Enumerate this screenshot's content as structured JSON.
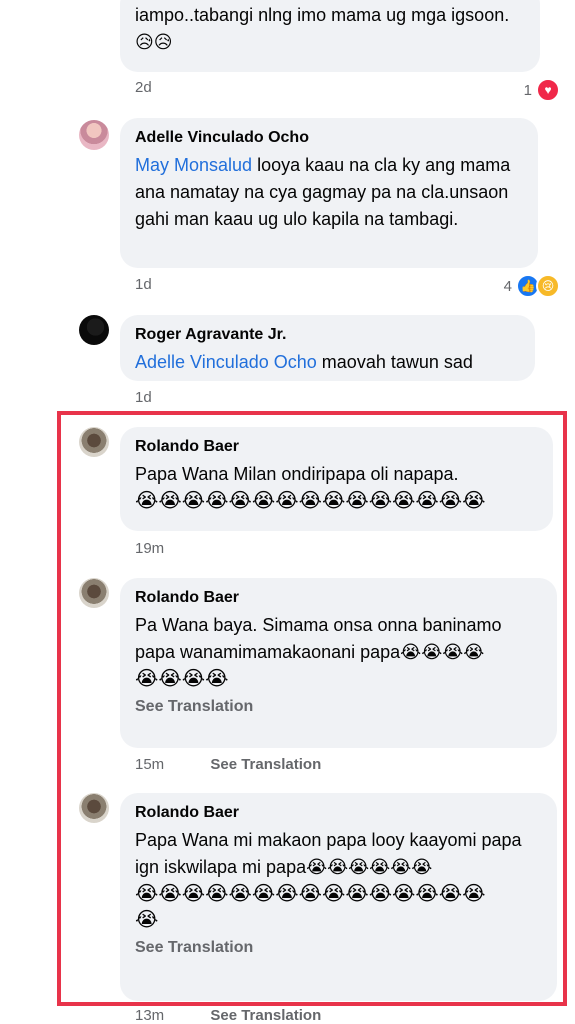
{
  "comments": [
    {
      "text": "iampo..tabangi nlng imo mama ug mga igsoon.😥😥",
      "time": "2d",
      "reaction_count": "1",
      "reaction_icons": [
        "heart-icon"
      ]
    },
    {
      "name": "Adelle Vinculado Ocho",
      "mention": "May Monsalud",
      "text": " looya kaau na cla ky ang mama ana namatay na cya gagmay pa na cla.unsaon gahi man kaau ug ulo kapila na tambagi.",
      "time": "1d",
      "reaction_count": "4",
      "reaction_icons": [
        "like-icon",
        "sad-icon"
      ]
    },
    {
      "name": "Roger Agravante Jr.",
      "mention": "Adelle Vinculado Ocho",
      "text": " maovah tawun sad",
      "time": "1d"
    },
    {
      "name": "Rolando Baer",
      "text": "Papa Wana Milan  ondiripapa   oli napapa.",
      "emojis": "😭😭😭😭😭😭😭😭😭😭😭😭😭😭😭",
      "time": "19m"
    },
    {
      "name": "Rolando Baer",
      "text": "Pa Wana baya. Simama onsa onna baninamo papa wanamimamakaonani papa😭😭😭😭",
      "emojis": "😭😭😭😭",
      "see_translation": "See Translation",
      "time": "15m",
      "meta_translation": "See Translation"
    },
    {
      "name": "Rolando Baer",
      "text": "Papa Wana mi makaon papa looy kaayomi papa ign iskwilapa mi papa😭😭😭😭😭😭",
      "emojis": "😭😭😭😭😭😭😭😭😭😭😭😭😭😭😭",
      "emojis2": "😭",
      "see_translation": "See Translation",
      "time": "13m",
      "meta_translation": "See Translation"
    }
  ],
  "colors": {
    "highlight_border": "#e8334a",
    "mention": "#216fdb",
    "bubble": "#f0f2f5",
    "meta": "#65676b"
  }
}
